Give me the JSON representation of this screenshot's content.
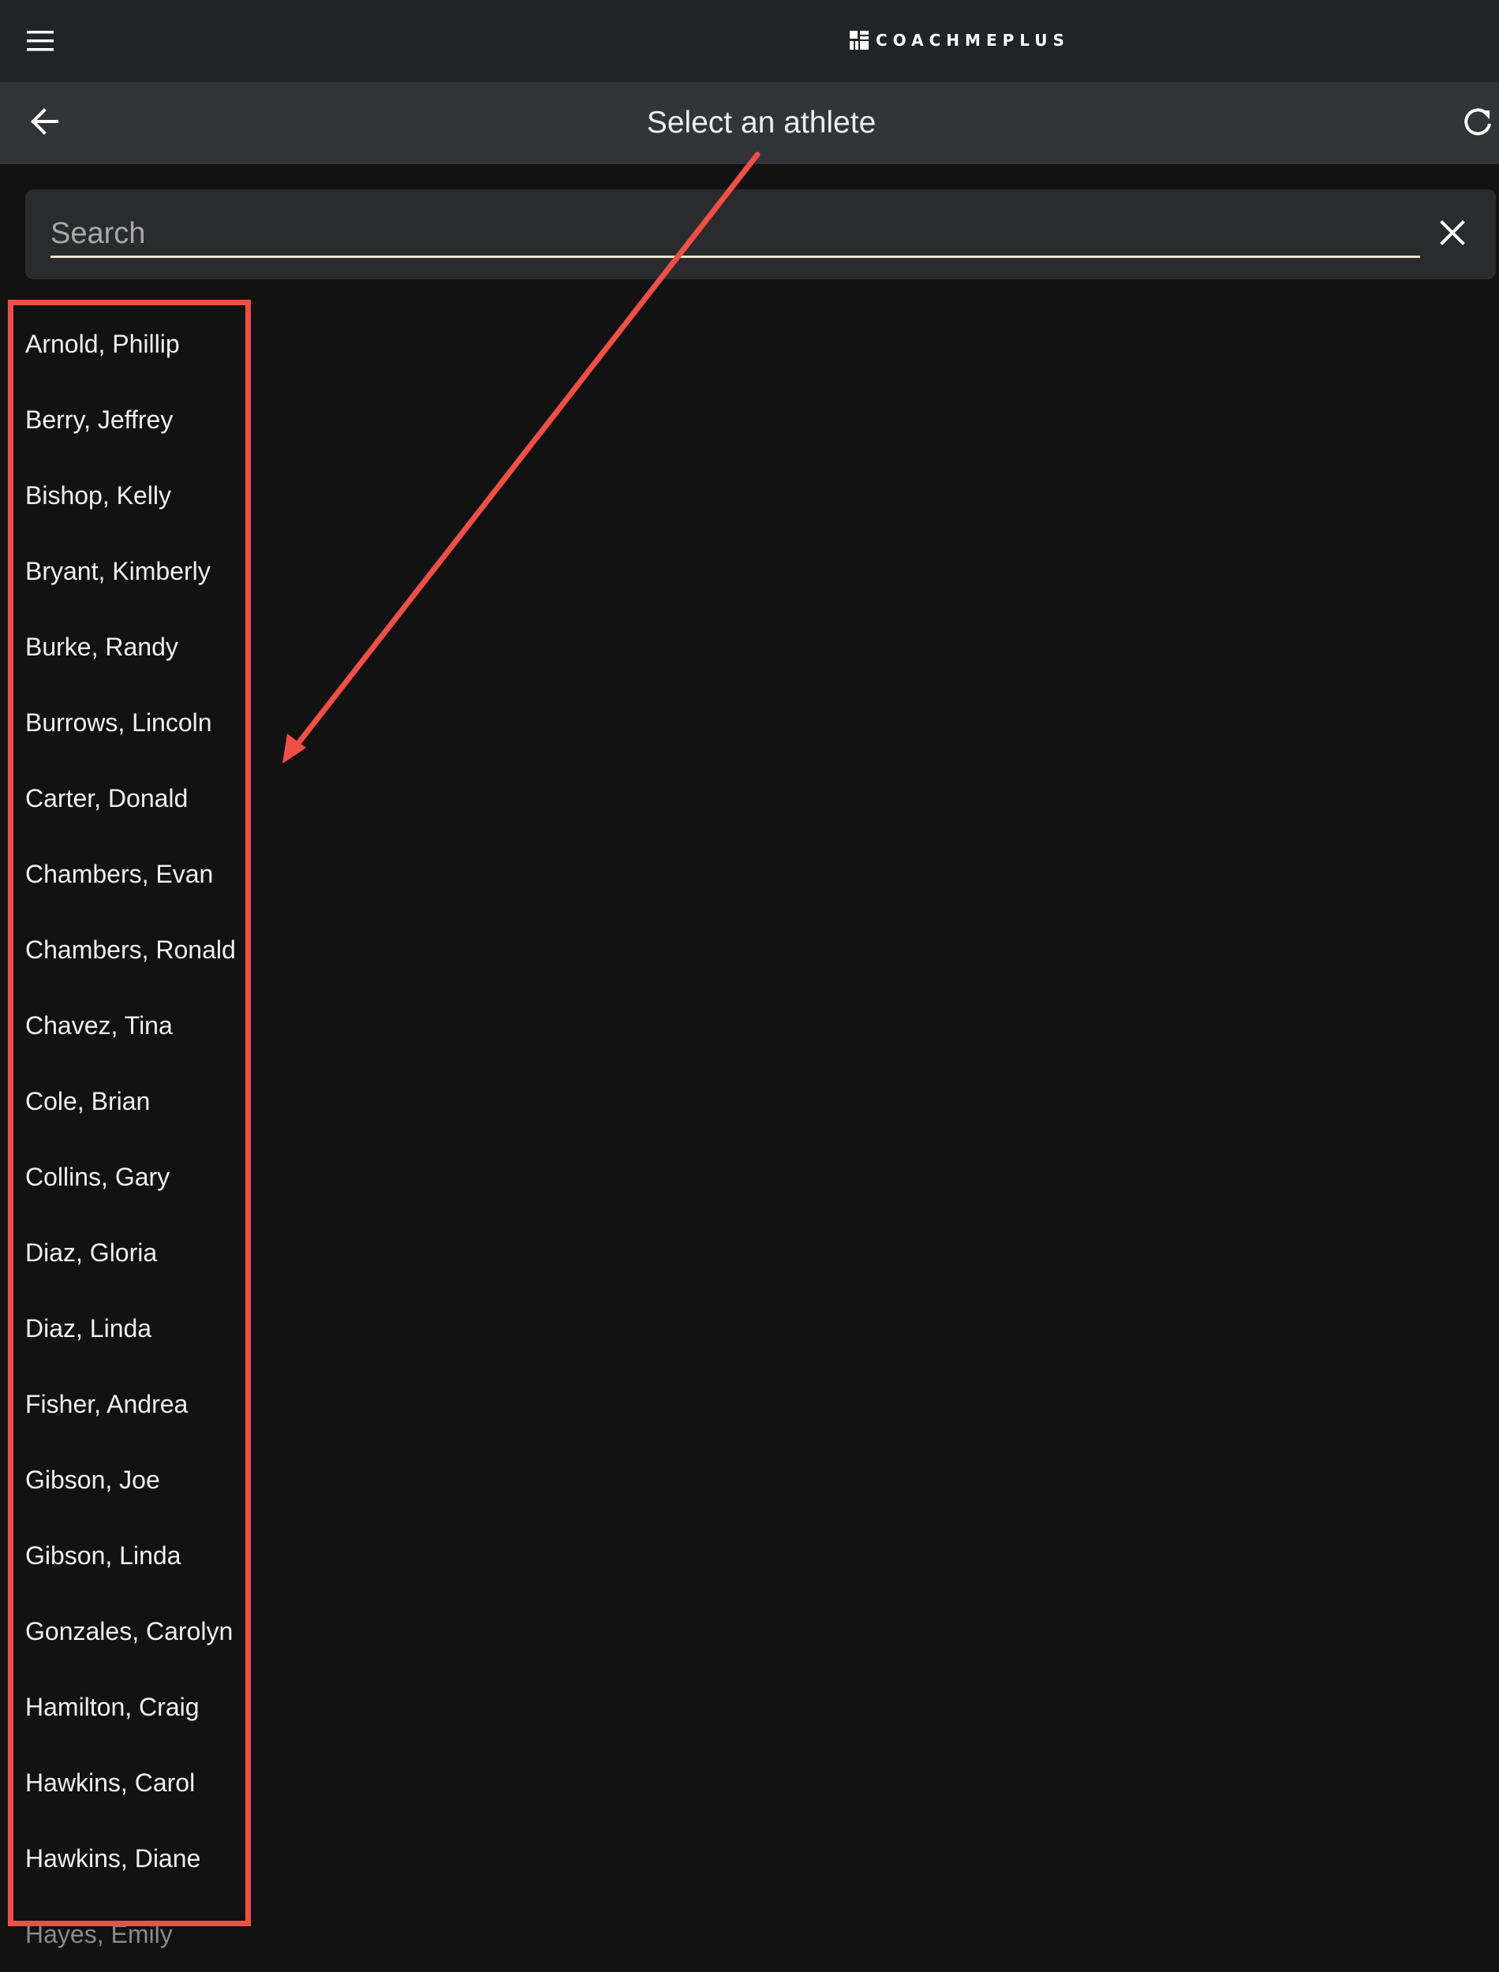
{
  "app": {
    "brand": "COACHMEPLUS"
  },
  "header": {
    "title": "Select an athlete"
  },
  "search": {
    "placeholder": "Search",
    "value": ""
  },
  "athletes": [
    "Arnold, Phillip",
    "Berry, Jeffrey",
    "Bishop, Kelly",
    "Bryant, Kimberly",
    "Burke, Randy",
    "Burrows, Lincoln",
    "Carter, Donald",
    "Chambers, Evan",
    "Chambers, Ronald",
    "Chavez, Tina",
    "Cole, Brian",
    "Collins, Gary",
    "Diaz, Gloria",
    "Diaz, Linda",
    "Fisher, Andrea",
    "Gibson, Joe",
    "Gibson, Linda",
    "Gonzales, Carolyn",
    "Hamilton, Craig",
    "Hawkins, Carol",
    "Hawkins, Diane",
    "Hayes, Emily"
  ],
  "icons": {
    "menu": "menu-icon",
    "back": "arrow-left-icon",
    "refresh": "refresh-icon",
    "clear": "close-icon",
    "logo": "logo-mark-icon"
  },
  "colors": {
    "background": "#121213",
    "topbar": "#222326",
    "subheader": "#323438",
    "search_card": "#2a2b2d",
    "annotation": "#ef4f47",
    "search_underline": "#eae7cf"
  }
}
